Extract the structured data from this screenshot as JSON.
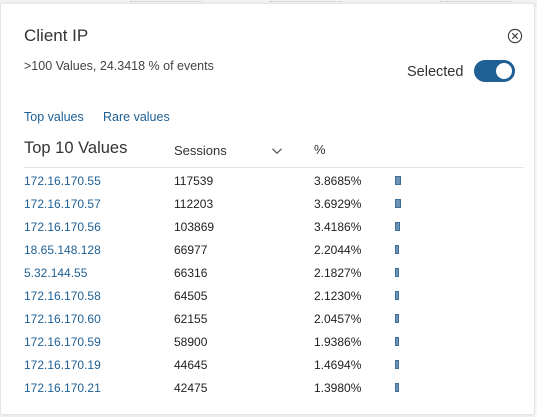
{
  "panel": {
    "title": "Client IP",
    "summary": ">100 Values, 24.3418 % of events",
    "selected_label": "Selected",
    "selected_on": true,
    "close_icon": "close-circle-icon"
  },
  "tabs": {
    "top_values": "Top values",
    "rare_values": "Rare values"
  },
  "table": {
    "title": "Top 10 Values",
    "col_sessions": "Sessions",
    "col_percent": "%",
    "sort_icon": "chevron-down-icon",
    "bar_color": "#6f93b5",
    "rows": [
      {
        "ip": "172.16.170.55",
        "sessions": "117539",
        "percent": "3.8685%",
        "share": 3.8685
      },
      {
        "ip": "172.16.170.57",
        "sessions": "112203",
        "percent": "3.6929%",
        "share": 3.6929
      },
      {
        "ip": "172.16.170.56",
        "sessions": "103869",
        "percent": "3.4186%",
        "share": 3.4186
      },
      {
        "ip": "18.65.148.128",
        "sessions": "66977",
        "percent": "2.2044%",
        "share": 2.2044
      },
      {
        "ip": "5.32.144.55",
        "sessions": "66316",
        "percent": "2.1827%",
        "share": 2.1827
      },
      {
        "ip": "172.16.170.58",
        "sessions": "64505",
        "percent": "2.1230%",
        "share": 2.123
      },
      {
        "ip": "172.16.170.60",
        "sessions": "62155",
        "percent": "2.0457%",
        "share": 2.0457
      },
      {
        "ip": "172.16.170.59",
        "sessions": "58900",
        "percent": "1.9386%",
        "share": 1.9386
      },
      {
        "ip": "172.16.170.19",
        "sessions": "44645",
        "percent": "1.4694%",
        "share": 1.4694
      },
      {
        "ip": "172.16.170.21",
        "sessions": "42475",
        "percent": "1.3980%",
        "share": 1.398
      }
    ]
  }
}
